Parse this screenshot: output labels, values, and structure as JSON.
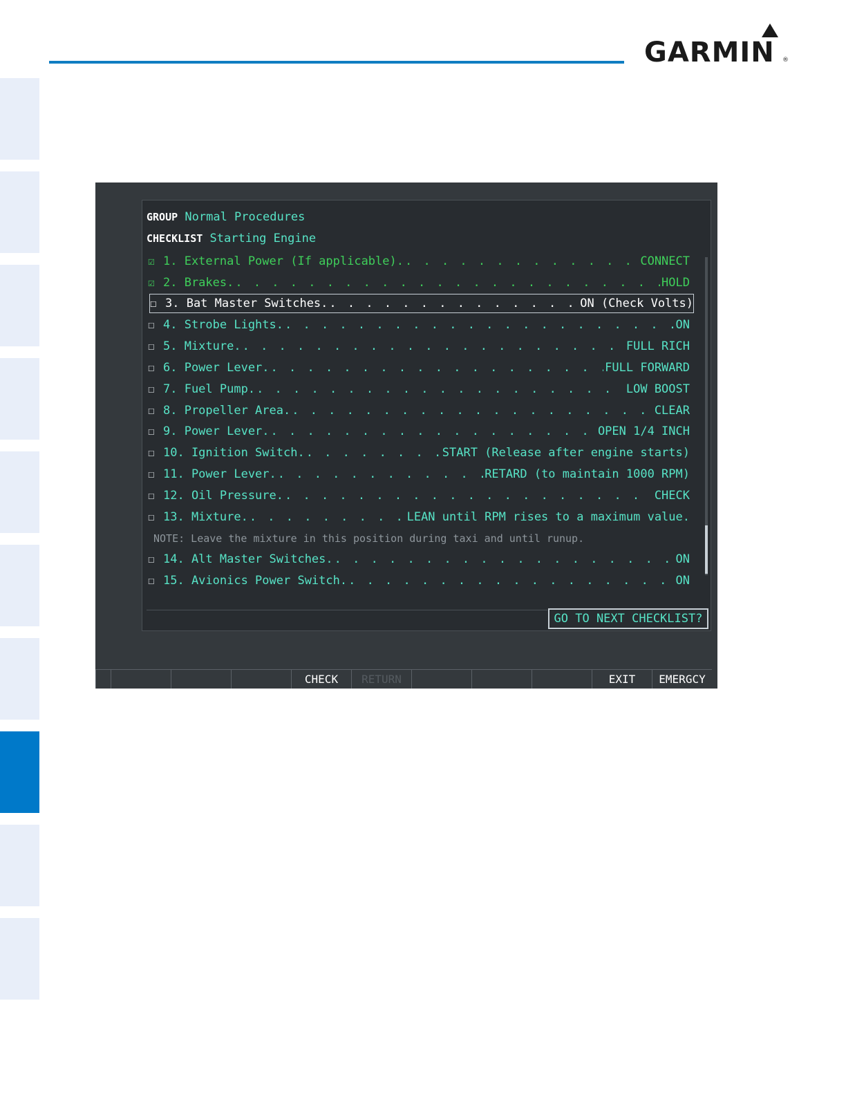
{
  "branding": {
    "logo_text": "GARMIN",
    "registered_mark": "®"
  },
  "colors": {
    "accent_blue": "#0f7dc2",
    "active_tab": "#0079c9",
    "completed_item": "#3fcf5a",
    "pending_item": "#57e3c6",
    "screen_bg": "#34393d"
  },
  "checklist": {
    "group_key": "GROUP",
    "group_value": "Normal Procedures",
    "checklist_key": "CHECKLIST",
    "checklist_value": "Starting Engine",
    "items": [
      {
        "mark": "☑",
        "label": "1. External Power (If applicable).",
        "action": "CONNECT",
        "state": "done"
      },
      {
        "mark": "☑",
        "label": "2. Brakes.",
        "action": "HOLD",
        "state": "done"
      },
      {
        "mark": "☐",
        "label": "3. Bat Master Switches.",
        "action": "ON (Check Volts)",
        "state": "current"
      },
      {
        "mark": "☐",
        "label": "4. Strobe Lights.",
        "action": "ON",
        "state": "pending"
      },
      {
        "mark": "☐",
        "label": "5. Mixture.",
        "action": "FULL RICH",
        "state": "pending"
      },
      {
        "mark": "☐",
        "label": "6. Power Lever.",
        "action": "FULL FORWARD",
        "state": "pending"
      },
      {
        "mark": "☐",
        "label": "7. Fuel Pump.",
        "action": "LOW BOOST",
        "state": "pending"
      },
      {
        "mark": "☐",
        "label": "8. Propeller Area.",
        "action": "CLEAR",
        "state": "pending"
      },
      {
        "mark": "☐",
        "label": "9. Power Lever.",
        "action": "OPEN 1/4 INCH",
        "state": "pending"
      },
      {
        "mark": "☐",
        "label": "10. Ignition Switch.",
        "action": "START (Release after engine starts)",
        "state": "pending"
      },
      {
        "mark": "☐",
        "label": "11. Power Lever.",
        "action": "RETARD (to maintain 1000 RPM)",
        "state": "pending"
      },
      {
        "mark": "☐",
        "label": "12. Oil Pressure.",
        "action": "CHECK",
        "state": "pending"
      },
      {
        "mark": "☐",
        "label": "13. Mixture.",
        "action": "LEAN until RPM rises to a maximum value.",
        "state": "pending"
      },
      {
        "mark": "☐",
        "label": "14. Alt Master Switches.",
        "action": "ON",
        "state": "pending"
      },
      {
        "mark": "☐",
        "label": "15. Avionics Power Switch.",
        "action": "ON",
        "state": "pending"
      }
    ],
    "note": "NOTE:  Leave the mixture in this position during taxi and until runup.",
    "next_button": "GO TO NEXT CHECKLIST?"
  },
  "softkeys": [
    "",
    "",
    "",
    "",
    "CHECK",
    "RETURN",
    "",
    "",
    "",
    "EXIT",
    "EMERGCY"
  ]
}
